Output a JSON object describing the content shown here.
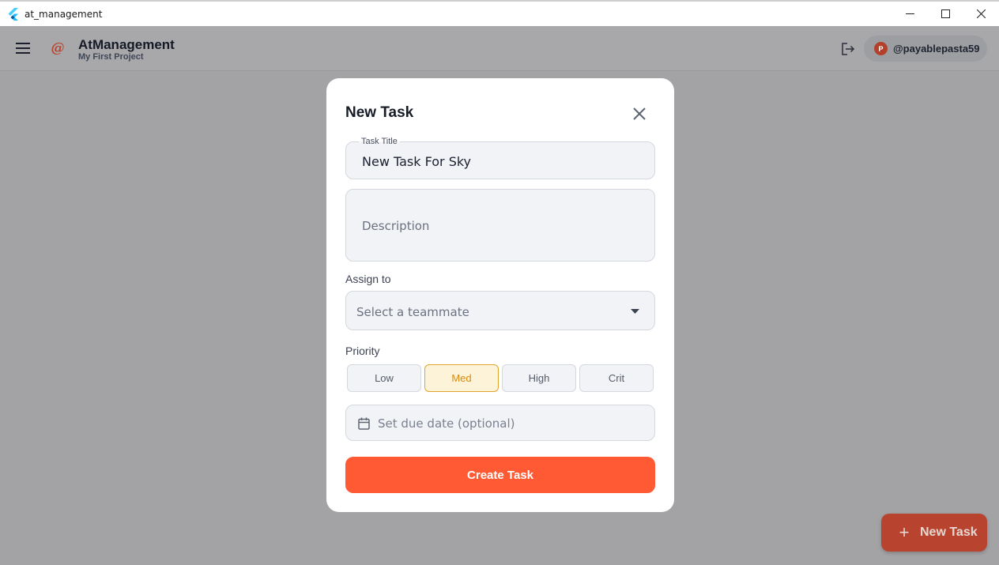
{
  "window": {
    "title": "at_management",
    "minimize_icon": "minimize-icon",
    "maximize_icon": "maximize-icon",
    "close_icon": "close-icon"
  },
  "header": {
    "menu_icon": "hamburger-menu-icon",
    "logo_glyph": "@",
    "app_name": "AtManagement",
    "project_name": "My First Project",
    "logout_icon": "logout-icon",
    "user": {
      "avatar_initial": "P",
      "handle": "@payablepasta59"
    }
  },
  "fab": {
    "icon": "plus-icon",
    "label": "New Task"
  },
  "dialog": {
    "title": "New Task",
    "close_icon": "close-icon",
    "task_title": {
      "label": "Task Title",
      "value": "New Task For Sky"
    },
    "description": {
      "placeholder": "Description"
    },
    "assign": {
      "label": "Assign to",
      "placeholder": "Select a teammate"
    },
    "priority": {
      "label": "Priority",
      "options": [
        "Low",
        "Med",
        "High",
        "Crit"
      ],
      "selected": "Med"
    },
    "due_date": {
      "icon": "calendar-icon",
      "placeholder": "Set due date (optional)"
    },
    "submit_label": "Create Task"
  },
  "colors": {
    "accent": "#ff5a33",
    "priority_selected_bg": "#fdf3d9",
    "priority_selected_text": "#d98a0c"
  }
}
